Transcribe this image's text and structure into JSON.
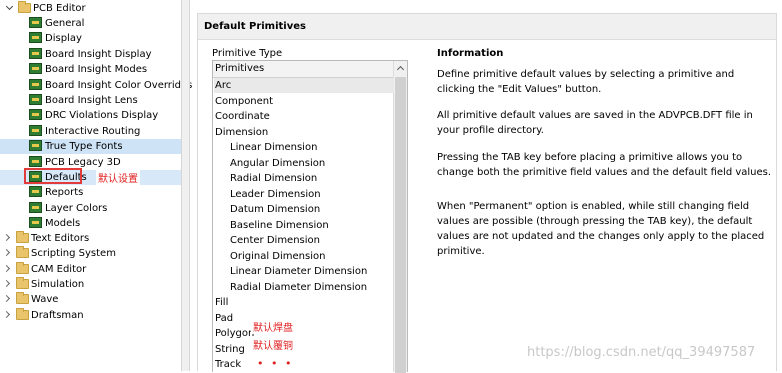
{
  "tree": {
    "root": "PCB Editor",
    "children": [
      "General",
      "Display",
      "Board Insight Display",
      "Board Insight Modes",
      "Board Insight Color Overrides",
      "Board Insight Lens",
      "DRC Violations Display",
      "Interactive Routing",
      "True Type Fonts",
      "PCB Legacy 3D",
      "Defaults",
      "Reports",
      "Layer Colors",
      "Models"
    ],
    "folders": [
      "Text Editors",
      "Scripting System",
      "CAM Editor",
      "Simulation",
      "Wave",
      "Draftsman"
    ]
  },
  "annotations": {
    "defaults": "默认设置",
    "pad": "默认焊盘",
    "polygon": "默认覆铜",
    "dots": "• • •"
  },
  "panel": {
    "title": "Default Primitives",
    "primitive_type_label": "Primitive Type",
    "list_header": "Primitives",
    "items": [
      {
        "label": "Arc",
        "sub": false
      },
      {
        "label": "Component",
        "sub": false
      },
      {
        "label": "Coordinate",
        "sub": false
      },
      {
        "label": "Dimension",
        "sub": false
      },
      {
        "label": "Linear Dimension",
        "sub": true
      },
      {
        "label": "Angular Dimension",
        "sub": true
      },
      {
        "label": "Radial Dimension",
        "sub": true
      },
      {
        "label": "Leader Dimension",
        "sub": true
      },
      {
        "label": "Datum Dimension",
        "sub": true
      },
      {
        "label": "Baseline Dimension",
        "sub": true
      },
      {
        "label": "Center Dimension",
        "sub": true
      },
      {
        "label": "Original Dimension",
        "sub": true
      },
      {
        "label": "Linear Diameter Dimension",
        "sub": true
      },
      {
        "label": "Radial Diameter Dimension",
        "sub": true
      },
      {
        "label": "Fill",
        "sub": false
      },
      {
        "label": "Pad",
        "sub": false
      },
      {
        "label": "Polygon",
        "sub": false
      },
      {
        "label": "String",
        "sub": false
      },
      {
        "label": "Track",
        "sub": false
      }
    ],
    "info_title": "Information",
    "info": [
      "Define primitive default values by selecting a primitive and clicking the \"Edit Values\" button.",
      "All primitive default values are saved in the ADVPCB.DFT file in your profile directory.",
      "Pressing the TAB key before placing a primitive allows you to change both the primitive field values and the default field values.",
      "When \"Permanent\" option is enabled, while still changing field values are possible (through pressing the TAB key), the default values are not updated and the changes only apply to the placed primitive."
    ]
  },
  "watermark": "https://blog.csdn.net/qq_39497587"
}
